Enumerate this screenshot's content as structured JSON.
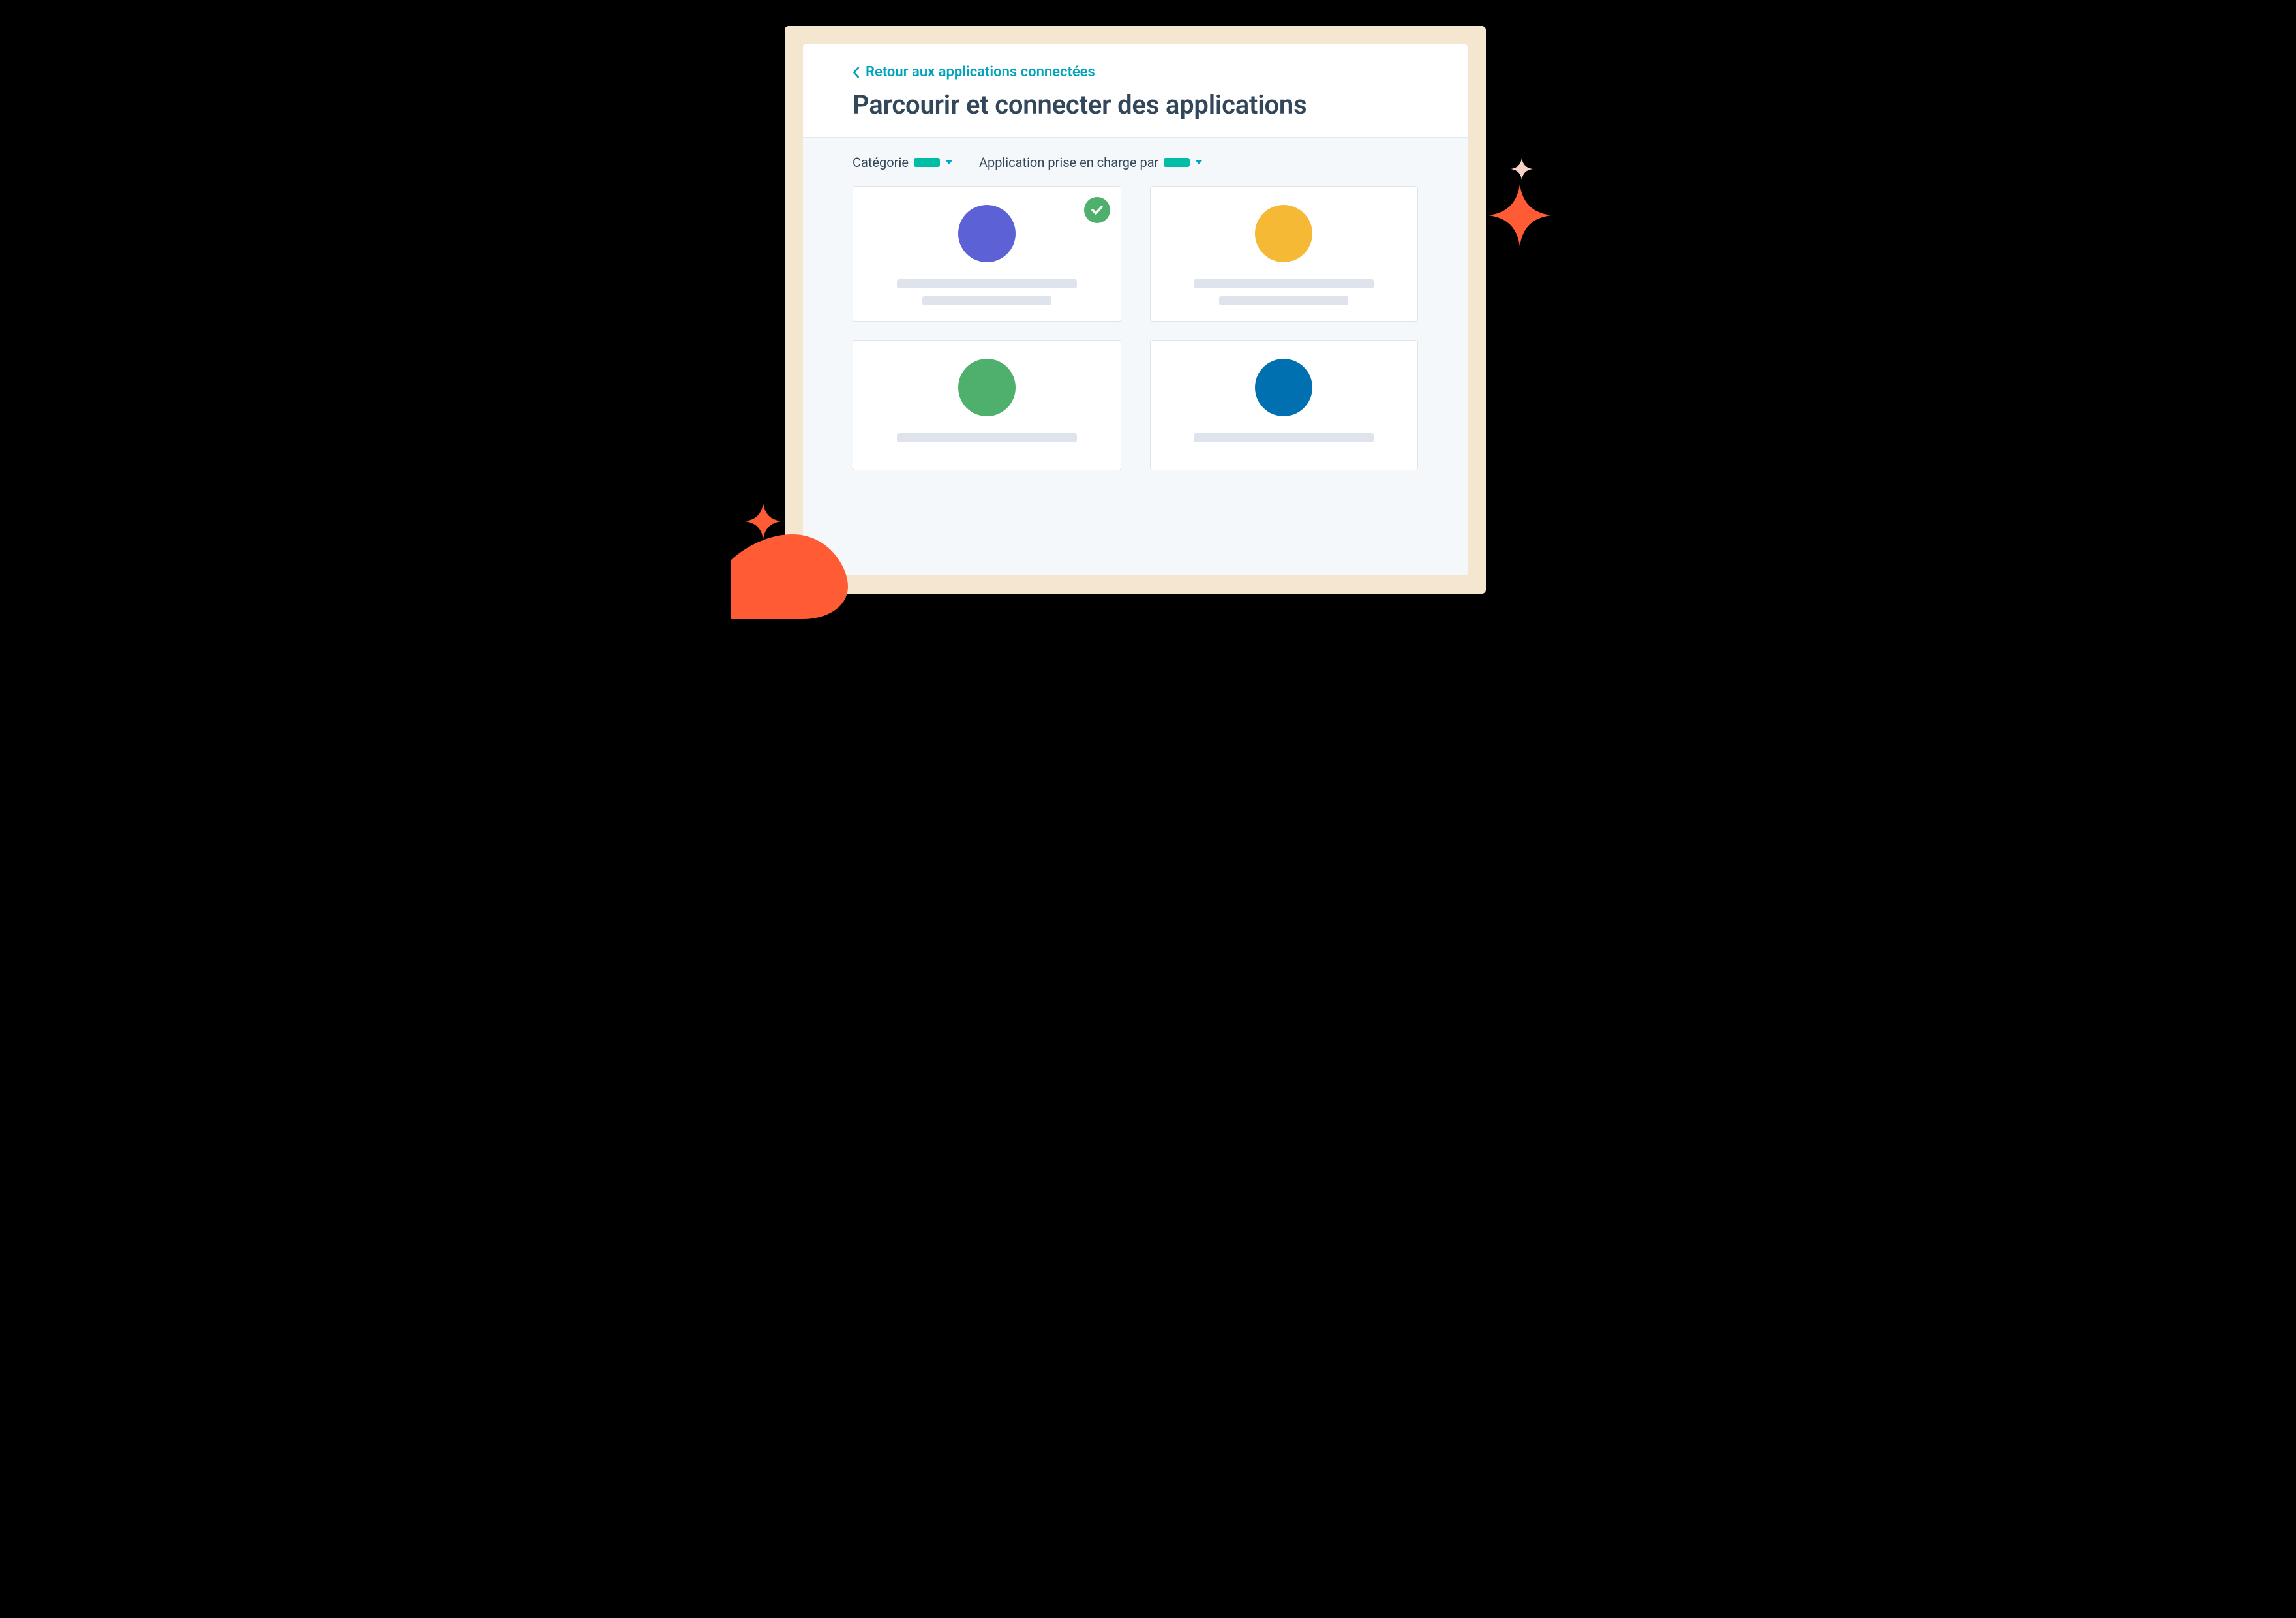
{
  "header": {
    "back_label": "Retour aux applications connectées",
    "title": "Parcourir et connecter des applications"
  },
  "filters": {
    "category_label": "Catégorie",
    "supported_by_label": "Application prise en charge par"
  },
  "cards": [
    {
      "avatar_color": "#5c62d6",
      "checked": true
    },
    {
      "avatar_color": "#f5b935",
      "checked": false
    },
    {
      "avatar_color": "#4fb06d",
      "checked": false
    },
    {
      "avatar_color": "#0070b0",
      "checked": false
    }
  ],
  "colors": {
    "teal": "#00a4bd",
    "teal_pill": "#00bda5",
    "text": "#33475b",
    "border": "#dfe3eb",
    "panel_bg": "#f5f8fa",
    "frame_bg": "#f4e6cf",
    "orange": "#ff5c35",
    "pale_pink": "#f6d2c6",
    "green_check": "#4fb06d"
  }
}
